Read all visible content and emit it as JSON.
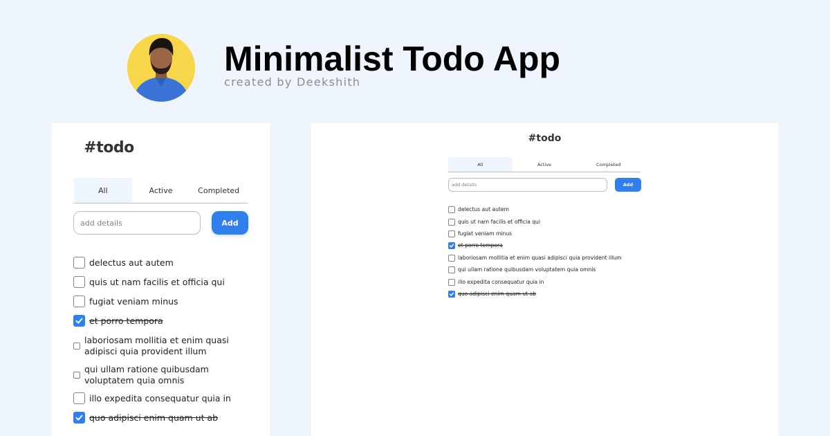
{
  "header": {
    "title": "Minimalist Todo App",
    "subtitle": "created by Deekshith",
    "avatar_bg": "#f7d64a"
  },
  "app": {
    "heading": "#todo",
    "tabs": [
      {
        "label": "All",
        "active": true
      },
      {
        "label": "Active",
        "active": false
      },
      {
        "label": "Completed",
        "active": false
      }
    ],
    "input_placeholder": "add details",
    "add_label": "Add",
    "accent_color": "#2f80ed",
    "tasks": [
      {
        "label": "delectus aut autem",
        "completed": false
      },
      {
        "label": "quis ut nam facilis et officia qui",
        "completed": false
      },
      {
        "label": "fugiat veniam minus",
        "completed": false
      },
      {
        "label": "et porro tempora",
        "completed": true
      },
      {
        "label": "laboriosam mollitia et enim quasi adipisci quia provident illum",
        "completed": false
      },
      {
        "label": "qui ullam ratione quibusdam voluptatem quia omnis",
        "completed": false
      },
      {
        "label": "illo expedita consequatur quia in",
        "completed": false
      },
      {
        "label": "quo adipisci enim quam ut ab",
        "completed": true
      }
    ]
  }
}
